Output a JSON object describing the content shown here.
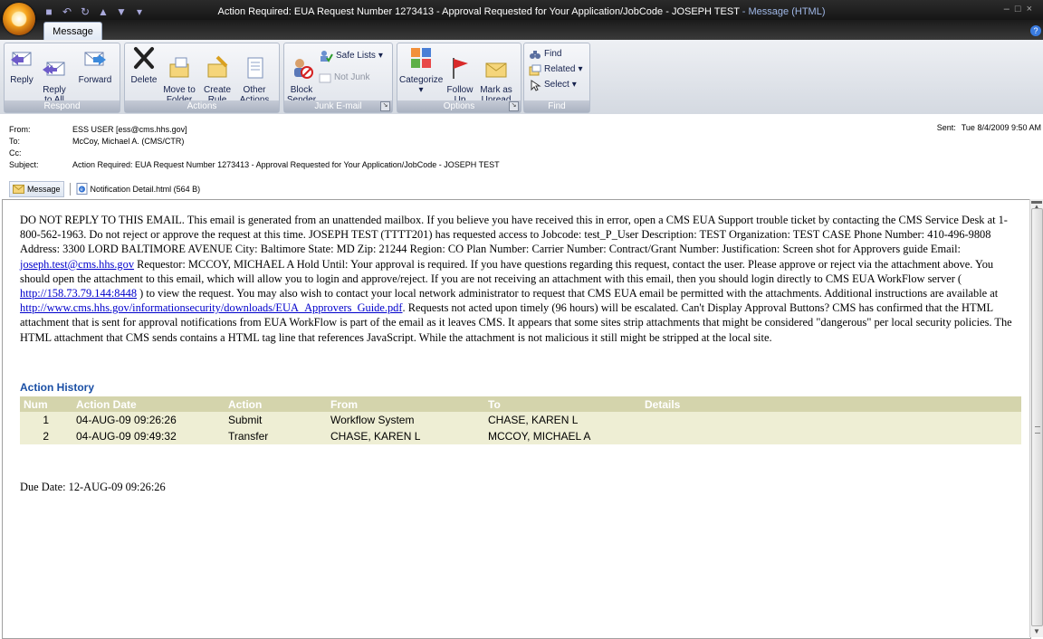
{
  "window": {
    "title_main": "Action Required: EUA Request Number 1273413 - Approval Requested for Your Application/JobCode - JOSEPH TEST",
    "title_suffix": "- Message (HTML)"
  },
  "ribbon": {
    "tab": "Message",
    "respond": {
      "label": "Respond",
      "reply": "Reply",
      "reply_all": "Reply\nto All",
      "forward": "Forward"
    },
    "actions": {
      "label": "Actions",
      "delete": "Delete",
      "move": "Move to\nFolder",
      "create_rule": "Create\nRule",
      "other": "Other\nActions"
    },
    "junk": {
      "label": "Junk E-mail",
      "block": "Block\nSender",
      "safe_lists": "Safe Lists",
      "not_junk": "Not Junk"
    },
    "options": {
      "label": "Options",
      "categorize": "Categorize",
      "follow_up": "Follow\nUp",
      "mark_unread": "Mark as\nUnread"
    },
    "find": {
      "label": "Find",
      "find": "Find",
      "related": "Related",
      "select": "Select"
    }
  },
  "header": {
    "from_label": "From:",
    "from": "ESS USER [ess@cms.hhs.gov]",
    "to_label": "To:",
    "to": "McCoy, Michael A. (CMS/CTR)",
    "cc_label": "Cc:",
    "cc": "",
    "subject_label": "Subject:",
    "subject": "Action Required: EUA Request Number 1273413 - Approval Requested for Your Application/JobCode - JOSEPH TEST",
    "sent_label": "Sent:",
    "sent": "Tue 8/4/2009 9:50 AM"
  },
  "attachments": {
    "message": "Message",
    "file": "Notification Detail.html (564 B)"
  },
  "body": {
    "p1": "DO NOT REPLY TO THIS EMAIL. This email is generated from an unattended mailbox. If you believe you have received this in error, open a CMS EUA Support trouble ticket by contacting the CMS Service Desk at 1-800-562-1963. Do not reject or approve the request at this time. JOSEPH TEST (TTTT201) has requested access to Jobcode: test_P_User Description: TEST Organization: TEST CASE Phone Number: 410-496-9808 Address: 3300 LORD BALTIMORE AVENUE City: Baltimore State: MD Zip: 21244 Region: CO Plan Number: Carrier Number: Contract/Grant Number: Justification: Screen shot for Approvers guide Email: ",
    "email_link": "joseph.test@cms.hhs.gov",
    "p2": " Requestor: MCCOY, MICHAEL A Hold Until: Your approval is required. If you have questions regarding this request, contact the user. Please approve or reject via the attachment above. You should open the attachment to this email, which will allow you to login and approve/reject. If you are not receiving an attachment with this email, then you should login directly to CMS EUA WorkFlow server ( ",
    "server_link": "http://158.73.79.144:8448",
    "p3": " ) to view the request. You may also wish to contact your local network administrator to request that CMS EUA email be permitted with the attachments. Additional instructions are available at ",
    "guide_link": "http://www.cms.hhs.gov/informationsecurity/downloads/EUA_Approvers_Guide.pdf",
    "p4": ". Requests not acted upon timely (96 hours) will be escalated. Can't Display Approval Buttons? CMS has confirmed that the HTML attachment that is sent for approval notifications from EUA WorkFlow is part of the email as it leaves CMS. It appears that some sites strip attachments that might be considered \"dangerous\" per local security policies. The HTML attachment that CMS sends contains a HTML tag line that references JavaScript. While the attachment is not malicious it still might be stripped at the local site.",
    "action_history_title": "Action History",
    "table": {
      "headers": [
        "Num",
        "Action Date",
        "Action",
        "From",
        "To",
        "Details"
      ],
      "rows": [
        [
          "1",
          "04-AUG-09 09:26:26",
          "Submit",
          "Workflow System",
          "CHASE, KAREN L",
          ""
        ],
        [
          "2",
          "04-AUG-09 09:49:32",
          "Transfer",
          "CHASE, KAREN L",
          "MCCOY, MICHAEL A",
          ""
        ]
      ]
    },
    "due_date": "Due Date: 12-AUG-09 09:26:26"
  }
}
